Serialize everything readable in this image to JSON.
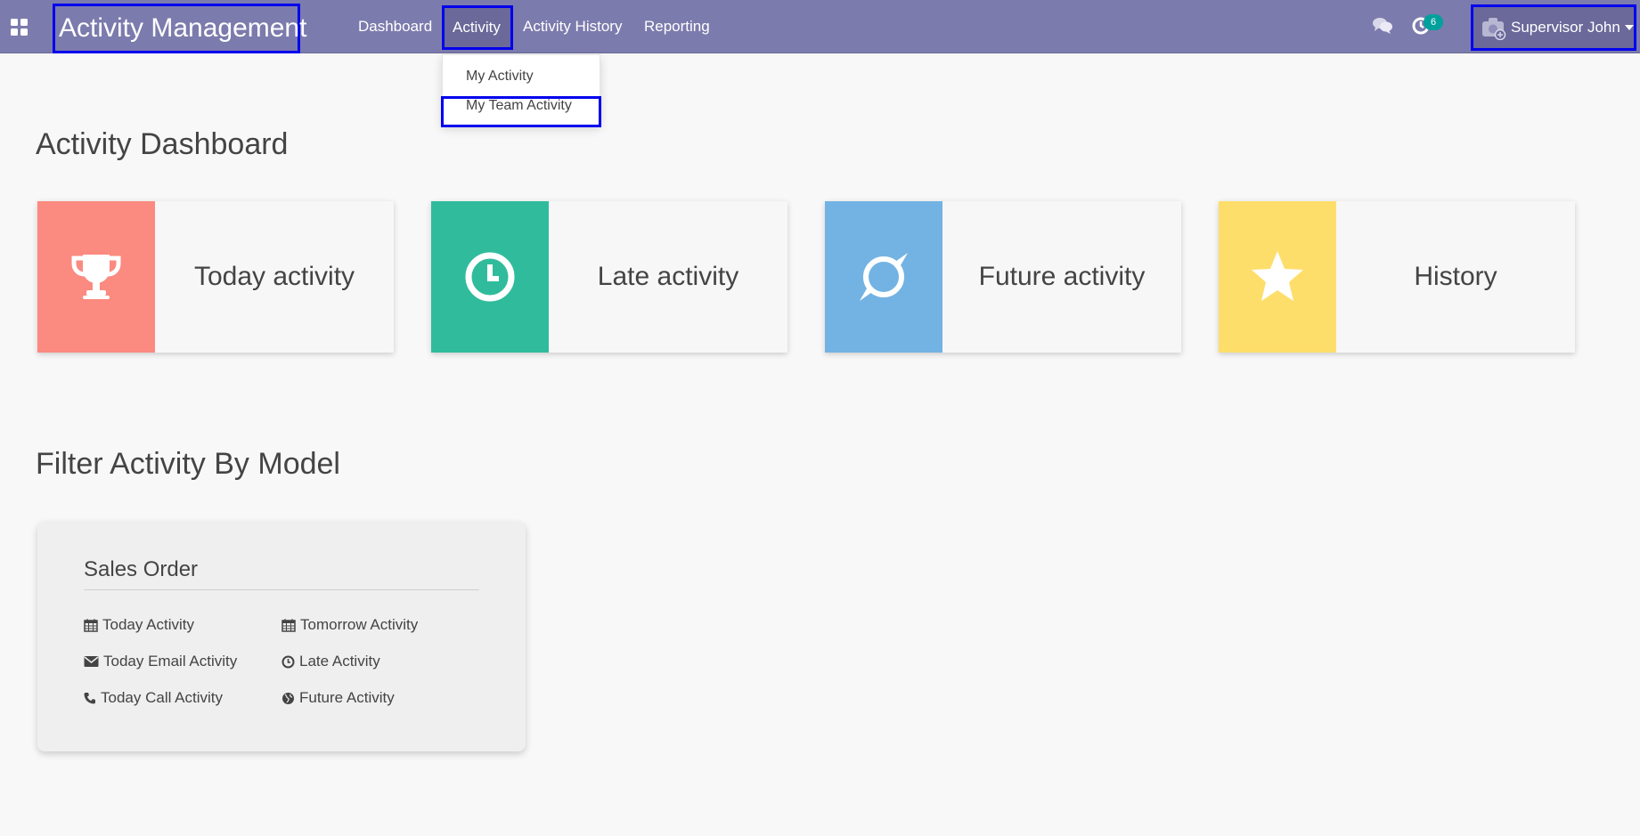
{
  "navbar": {
    "brand": "Activity Management",
    "menus": [
      "Dashboard",
      "Activity",
      "Activity History",
      "Reporting"
    ],
    "activity_badge": "6",
    "user_name": "Supervisor John",
    "background": "#7c7bad"
  },
  "activity_dropdown": {
    "items": [
      "My Activity",
      "My Team Activity"
    ]
  },
  "dashboard": {
    "title": "Activity Dashboard",
    "cards": [
      {
        "label": "Today activity",
        "icon": "trophy-icon",
        "color": "#fb8a80"
      },
      {
        "label": "Late activity",
        "icon": "clock-icon",
        "color": "#30bc9c"
      },
      {
        "label": "Future activity",
        "icon": "planet-icon",
        "color": "#73b3e3"
      },
      {
        "label": "History",
        "icon": "star-icon",
        "color": "#fede6b"
      }
    ]
  },
  "filter": {
    "title": "Filter Activity By Model",
    "model": {
      "name": "Sales Order",
      "links": [
        {
          "label": "Today Activity",
          "icon": "calendar-icon"
        },
        {
          "label": "Tomorrow Activity",
          "icon": "calendar-icon"
        },
        {
          "label": "Today Email Activity",
          "icon": "envelope-icon"
        },
        {
          "label": "Late Activity",
          "icon": "clock-icon"
        },
        {
          "label": "Today Call Activity",
          "icon": "phone-icon"
        },
        {
          "label": "Future Activity",
          "icon": "globe-icon"
        }
      ]
    }
  }
}
